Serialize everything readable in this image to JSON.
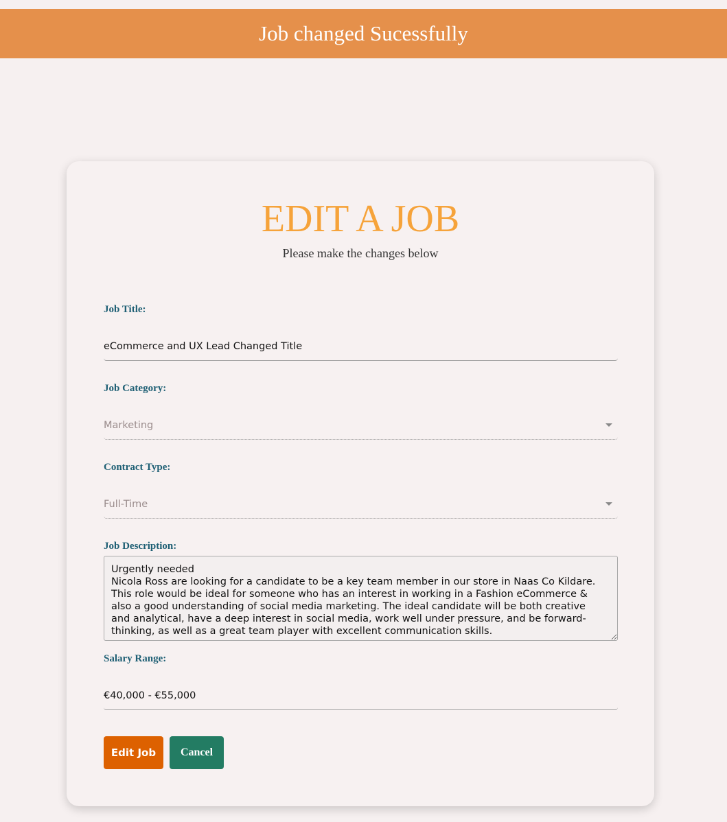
{
  "banner": {
    "message": "Job changed Sucessfully",
    "color": "#e5904b"
  },
  "form": {
    "title": "EDIT A JOB",
    "subtitle": "Please make the changes below",
    "job_title": {
      "label": "Job Title:",
      "value": "eCommerce and UX Lead Changed Title"
    },
    "job_category": {
      "label": "Job Category:",
      "value": "Marketing"
    },
    "contract_type": {
      "label": "Contract Type:",
      "value": "Full-Time"
    },
    "job_description": {
      "label": "Job Description:",
      "value": "Urgently needed\nNicola Ross are looking for a candidate to be a key team member in our store in Naas Co Kildare. This role would be ideal for someone who has an interest in working in a Fashion eCommerce & also a good understanding of social media marketing. The ideal candidate will be both creative and analytical, have a deep interest in social media, work well under pressure, and be forward-thinking, as well as a great team player with excellent communication skills."
    },
    "salary_range": {
      "label": "Salary Range:",
      "value": "€40,000 - €55,000"
    },
    "edit_button": "Edit Job",
    "cancel_button": "Cancel"
  },
  "colors": {
    "edit_button": "#dd6100",
    "cancel_button": "#237c63",
    "title": "#f6a33a"
  }
}
